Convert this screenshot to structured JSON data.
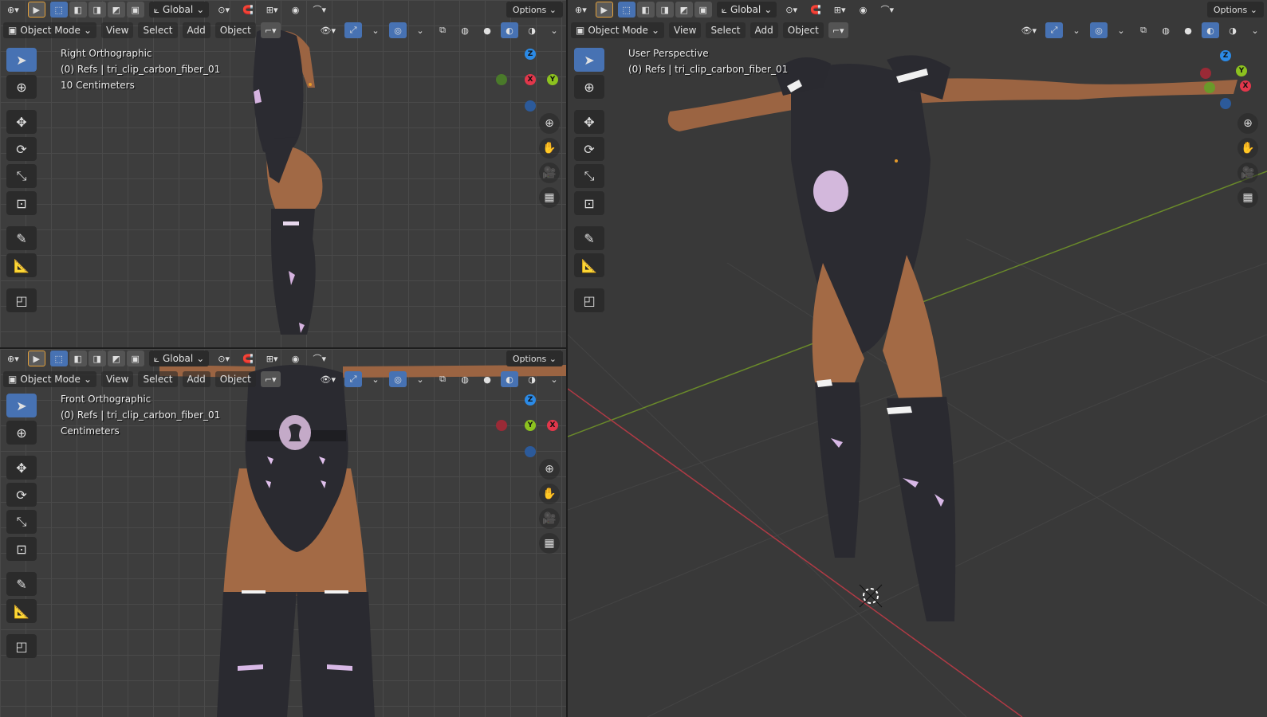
{
  "header": {
    "transform": "Global",
    "options": "Options",
    "mode": "Object Mode",
    "menus": [
      "View",
      "Select",
      "Add",
      "Object"
    ]
  },
  "viewports": {
    "top_left": {
      "view_name": "Right Orthographic",
      "object": "(0) Refs | tri_clip_carbon_fiber_01",
      "scale": "10 Centimeters"
    },
    "bottom_left": {
      "view_name": "Front Orthographic",
      "object": "(0) Refs | tri_clip_carbon_fiber_01",
      "scale": "Centimeters"
    },
    "right": {
      "view_name": "User Perspective",
      "object": "(0) Refs | tri_clip_carbon_fiber_01"
    }
  },
  "gizmo": {
    "axes": {
      "x": "X",
      "y": "Y",
      "z": "Z"
    },
    "colors": {
      "x": "#e2374b",
      "y": "#8cc21f",
      "z": "#2b8ae6"
    }
  },
  "colors": {
    "accent": "#4772b3",
    "skin": "#a06a46",
    "suit": "#2a2a2e",
    "glow": "#d8b8e6"
  }
}
